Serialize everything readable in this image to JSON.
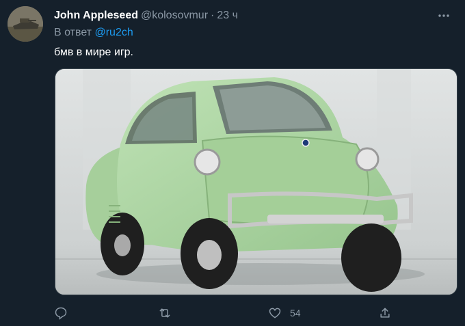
{
  "tweet": {
    "author_name": "John Appleseed",
    "author_handle": "@kolosovmur",
    "separator": "·",
    "time": "23 ч",
    "reply_prefix": "В ответ",
    "reply_to": "@ru2ch",
    "text": "бмв в мире игр.",
    "like_count": "54"
  },
  "media": {
    "subject": "mint green BMW Isetta bubble car photo",
    "car_color": "#a9d3a0",
    "background_color": "#d6dada"
  },
  "icons": [
    "avatar",
    "more-icon",
    "reply-icon",
    "retweet-icon",
    "like-icon",
    "share-icon"
  ],
  "colors": {
    "background": "#15202b",
    "text_primary": "#ffffff",
    "text_secondary": "#8b98a5",
    "accent": "#1d9bf0"
  }
}
